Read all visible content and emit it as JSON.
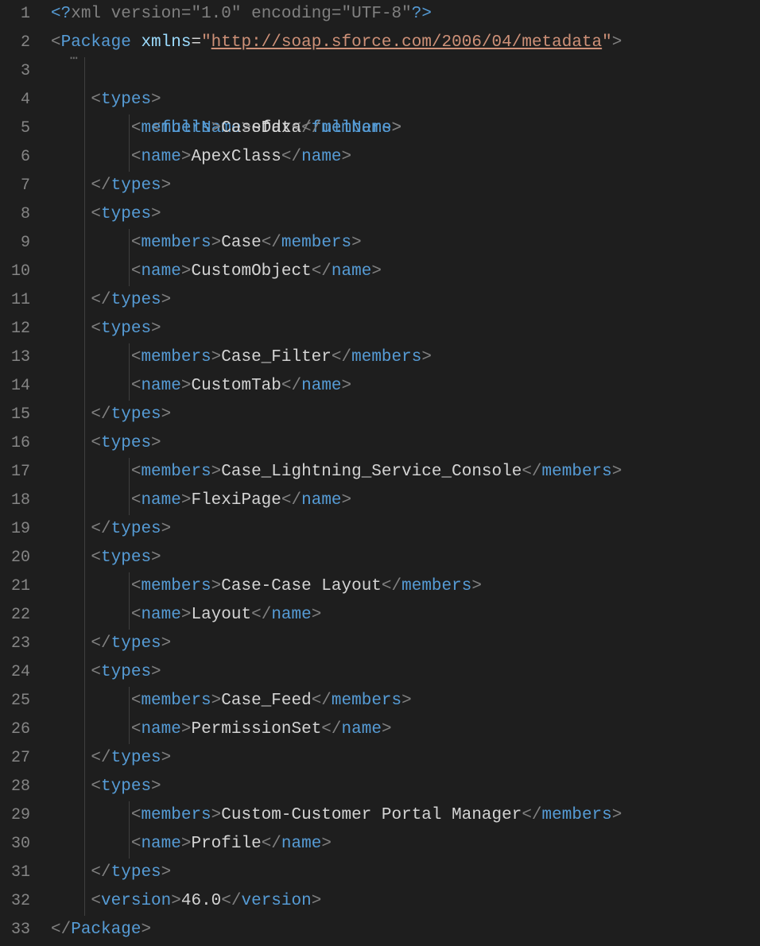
{
  "tokens": {
    "xmlDeclOpen": "<?",
    "xmlDeclName": "xml",
    "versionAttr": "version",
    "versionVal": "\"1.0\"",
    "encodingAttr": "encoding",
    "encodingVal": "\"UTF-8\"",
    "xmlDeclClose": "?>",
    "lt": "<",
    "gt": ">",
    "lts": "</",
    "eq": "=",
    "xmlnsAttr": "xmlns",
    "xmlnsValOpen": "\"",
    "xmlnsUrl": "http://soap.sforce.com/2006/04/metadata",
    "xmlnsValClose": "\"",
    "tagPackage": "Package",
    "tagFullName": "fullName",
    "tagTypes": "types",
    "tagMembers": "members",
    "tagName": "name",
    "tagVersion": "version",
    "foldDots": "⋯"
  },
  "content": {
    "fullName": "sfdx",
    "types": [
      {
        "members": "CaseData",
        "name": "ApexClass"
      },
      {
        "members": "Case",
        "name": "CustomObject"
      },
      {
        "members": "Case_Filter",
        "name": "CustomTab"
      },
      {
        "members": "Case_Lightning_Service_Console",
        "name": "FlexiPage"
      },
      {
        "members": "Case-Case Layout",
        "name": "Layout"
      },
      {
        "members": "Case_Feed",
        "name": "PermissionSet"
      },
      {
        "members": "Custom-Customer Portal Manager",
        "name": "Profile"
      }
    ],
    "version": "46.0"
  },
  "lineNumbers": [
    "1",
    "2",
    "3",
    "4",
    "5",
    "6",
    "7",
    "8",
    "9",
    "10",
    "11",
    "12",
    "13",
    "14",
    "15",
    "16",
    "17",
    "18",
    "19",
    "20",
    "21",
    "22",
    "23",
    "24",
    "25",
    "26",
    "27",
    "28",
    "29",
    "30",
    "31",
    "32",
    "33"
  ]
}
